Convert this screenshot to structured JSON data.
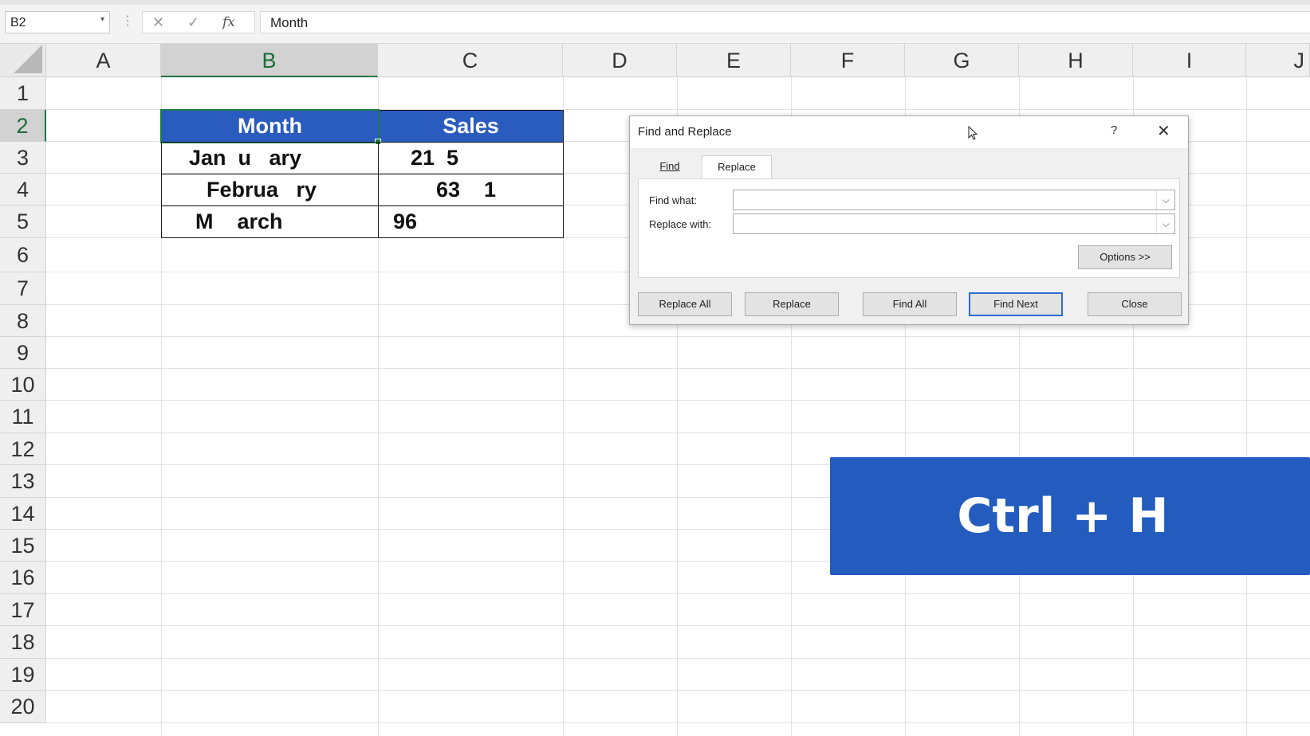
{
  "formula_bar": {
    "name_box": "B2",
    "cancel_icon": "✕",
    "enter_icon": "✓",
    "fx_label": "fx",
    "content": "Month"
  },
  "columns": [
    "A",
    "B",
    "C",
    "D",
    "E",
    "F",
    "G",
    "H",
    "I",
    "J"
  ],
  "rows": [
    "1",
    "2",
    "3",
    "4",
    "5",
    "6",
    "7",
    "8",
    "9",
    "10",
    "11",
    "12",
    "13",
    "14",
    "15",
    "16",
    "17",
    "18",
    "19",
    "20"
  ],
  "selected_column": "B",
  "selected_row": "2",
  "table": {
    "headers": [
      "Month",
      "Sales"
    ],
    "rows": [
      [
        "Jan  u   ary",
        "21  5"
      ],
      [
        "Februa   ry",
        "63    1"
      ],
      [
        "M    arch",
        "96"
      ]
    ]
  },
  "dialog": {
    "title": "Find and Replace",
    "help": "?",
    "close_icon": "✕",
    "tabs": [
      "Find",
      "Replace"
    ],
    "active_tab": "Replace",
    "find_label": "Find what:",
    "find_value": "",
    "replace_label": "Replace with:",
    "replace_value": "",
    "options_button": "Options >>",
    "buttons": [
      "Replace All",
      "Replace",
      "Find All",
      "Find Next",
      "Close"
    ],
    "default_button": "Find Next"
  },
  "shortcut_overlay": {
    "text": "Ctrl + H",
    "color": "#235bbf"
  },
  "colors": {
    "header_fill": "#2a5bbf",
    "selection_green": "#217346"
  }
}
